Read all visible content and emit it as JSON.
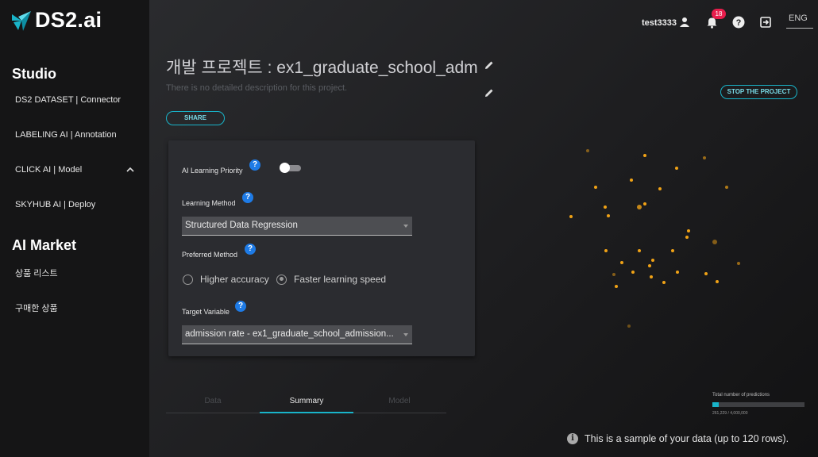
{
  "brand": {
    "name": "DS2.ai",
    "accent": "#19b4c9"
  },
  "sidebar": {
    "sections": [
      {
        "title": "Studio",
        "items": [
          {
            "label": "DS2 DATASET | Connector"
          },
          {
            "label": "LABELING AI | Annotation"
          },
          {
            "label": "CLICK AI | Model",
            "icon": "chevron-up-icon"
          },
          {
            "label": "SKYHUB AI | Deploy"
          }
        ]
      },
      {
        "title": "AI Market",
        "items": [
          {
            "label": "상품 리스트"
          },
          {
            "label": "구매한 상품"
          }
        ]
      }
    ]
  },
  "header": {
    "username": "test3333",
    "notification_count": "18",
    "language": "ENG"
  },
  "project": {
    "title": "개발 프로젝트 : ex1_graduate_school_adm",
    "description": "There is no detailed description for this project.",
    "share_label": "SHARE",
    "stop_label": "STOP THE PROJECT"
  },
  "settings": {
    "priority_label": "AI Learning Priority",
    "method_label": "Learning Method",
    "method_value": "Structured Data Regression",
    "preferred_label": "Preferred Method",
    "option_accuracy": "Higher accuracy",
    "option_speed": "Faster learning speed",
    "selected_option": "Faster learning speed",
    "target_label": "Target Variable",
    "target_value": "admission rate - ex1_graduate_school_admission..."
  },
  "tabs": [
    {
      "label": "Data",
      "active": false
    },
    {
      "label": "Summary",
      "active": true
    },
    {
      "label": "Model",
      "active": false
    }
  ],
  "predictions": {
    "label": "Total number of predictions",
    "count": "261,229 / 4,000,000",
    "fraction": 0.065
  },
  "sample_note": "This is a sample of your data (up to 120 rows)."
}
